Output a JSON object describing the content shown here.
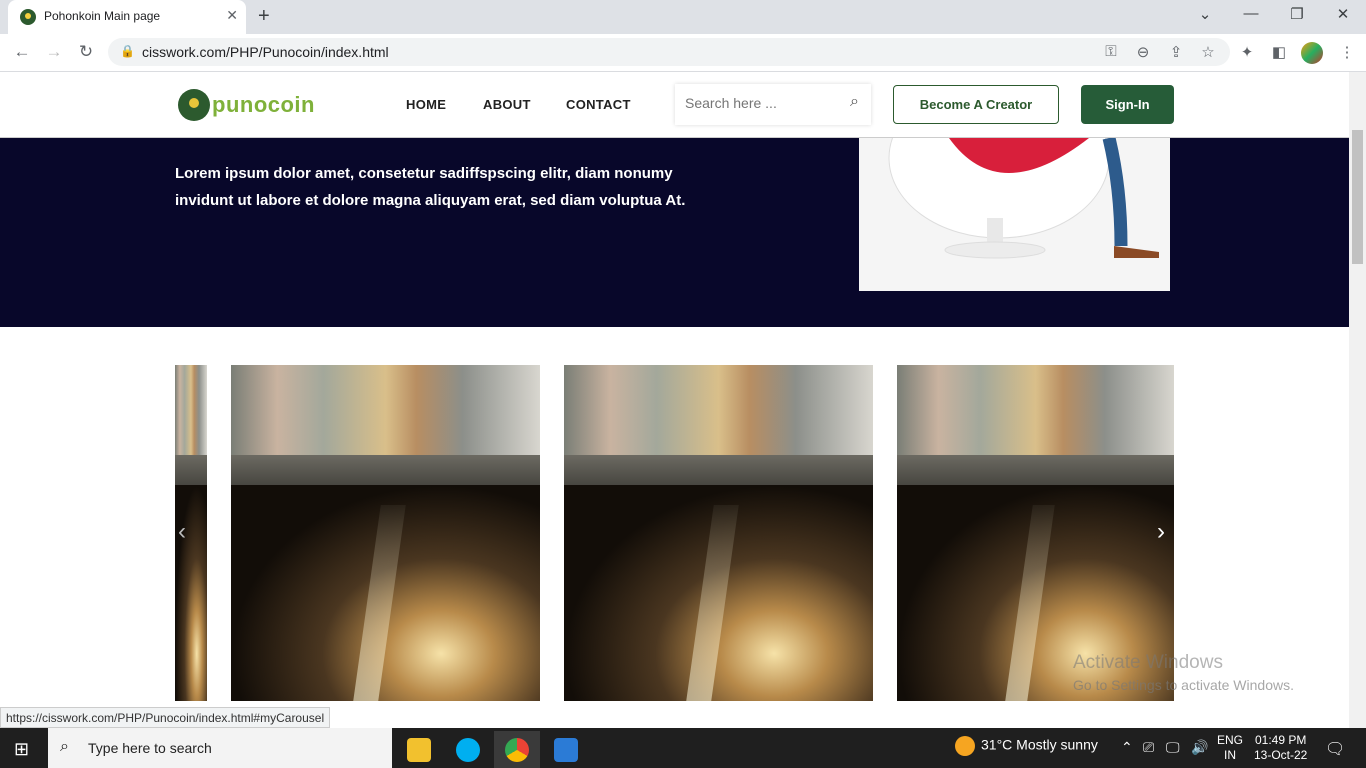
{
  "browser": {
    "tab_title": "Pohonkoin Main page",
    "tab_close": "✕",
    "new_tab": "+",
    "url": "cisswork.com/PHP/Punocoin/index.html",
    "status_url": "https://cisswork.com/PHP/Punocoin/index.html#myCarousel"
  },
  "site": {
    "logo_text": "punocoin",
    "nav": [
      "HOME",
      "ABOUT",
      "CONTACT"
    ],
    "search_placeholder": "Search here ...",
    "creator_button": "Become A Creator",
    "signin_button": "Sign-In",
    "hero_text": "Lorem ipsum dolor amet, consetetur sadiffspscing elitr, diam nonumy invidunt ut labore et dolore magna aliquyam erat, sed diam voluptua At."
  },
  "carousel": {
    "prev": "‹",
    "next": "›"
  },
  "watermark": {
    "line1": "Activate Windows",
    "line2": "Go to Settings to activate Windows."
  },
  "taskbar": {
    "search_placeholder": "Type here to search",
    "weather": "31°C  Mostly sunny",
    "lang_line1": "ENG",
    "lang_line2": "IN",
    "time": "01:49 PM",
    "date": "13-Oct-22"
  },
  "colors": {
    "brand_green": "#265c38",
    "logo_green": "#7fb13a",
    "hero_bg": "#08072a"
  }
}
